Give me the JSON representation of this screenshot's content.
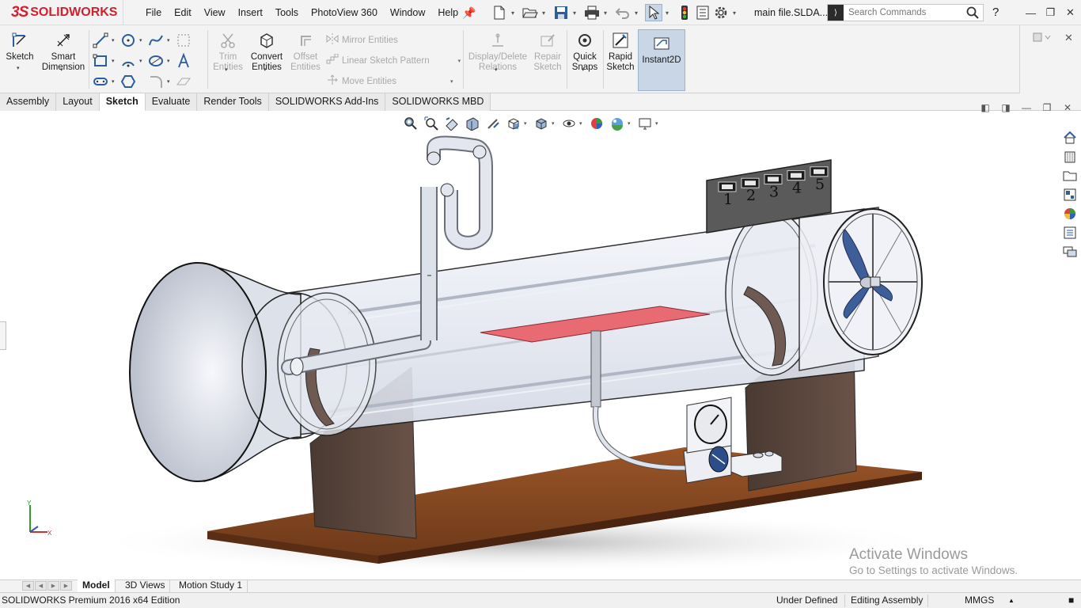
{
  "app": {
    "logo_ds": "3S",
    "logo_text": "SOLIDWORKS",
    "document_title": "main file.SLDA...",
    "search_placeholder": "Search Commands",
    "help_label": "?"
  },
  "menu": [
    "File",
    "Edit",
    "View",
    "Insert",
    "Tools",
    "PhotoView 360",
    "Window",
    "Help"
  ],
  "ribbon": {
    "sketch": "Sketch",
    "smart_dimension_1": "Smart",
    "smart_dimension_2": "Dimension",
    "trim_1": "Trim",
    "trim_2": "Entities",
    "convert_1": "Convert",
    "convert_2": "Entities",
    "offset_1": "Offset",
    "offset_2": "Entities",
    "mirror": "Mirror Entities",
    "linear_pattern": "Linear Sketch Pattern",
    "move": "Move Entities",
    "display_delete_1": "Display/Delete",
    "display_delete_2": "Relations",
    "repair_1": "Repair",
    "repair_2": "Sketch",
    "quick_snaps_1": "Quick",
    "quick_snaps_2": "Snaps",
    "rapid_1": "Rapid",
    "rapid_2": "Sketch",
    "instant2d": "Instant2D"
  },
  "tabs": [
    "Assembly",
    "Layout",
    "Sketch",
    "Evaluate",
    "Render Tools",
    "SOLIDWORKS Add-Ins",
    "SOLIDWORKS MBD"
  ],
  "active_tab": "Sketch",
  "model": {
    "display_labels": [
      "1",
      "2",
      "3",
      "4",
      "5"
    ]
  },
  "watermark": {
    "title": "Activate Windows",
    "subtitle": "Go to Settings to activate Windows."
  },
  "bottom_tabs": [
    "Model",
    "3D Views",
    "Motion Study 1"
  ],
  "status": {
    "edition": "SOLIDWORKS Premium 2016 x64 Edition",
    "definition": "Under Defined",
    "mode": "Editing Assembly",
    "units": "MMGS"
  },
  "colors": {
    "accent": "#d3202e",
    "selection": "#c8d6e6",
    "wood": "#8a4a22",
    "test_plate": "#e86a73"
  }
}
